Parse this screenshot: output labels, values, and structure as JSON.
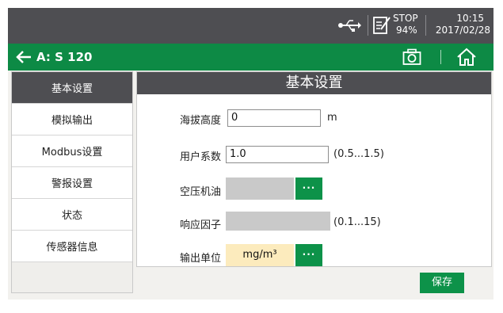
{
  "status_bar": {
    "mode": "STOP",
    "battery": "94%",
    "time": "10:15",
    "date": "2017/02/28",
    "icons": [
      "usb-icon",
      "document-edit-icon"
    ]
  },
  "title_bar": {
    "device": "A: S 120",
    "icons": [
      "back-arrow-icon",
      "camera-icon",
      "home-icon"
    ]
  },
  "sidebar": {
    "items": [
      {
        "label": "基本设置",
        "active": true
      },
      {
        "label": "模拟输出",
        "active": false
      },
      {
        "label": "Modbus设置",
        "active": false
      },
      {
        "label": "警报设置",
        "active": false
      },
      {
        "label": "状态",
        "active": false
      },
      {
        "label": "传感器信息",
        "active": false
      }
    ]
  },
  "panel": {
    "title": "基本设置",
    "altitude": {
      "label": "海拔高度",
      "value": "0",
      "unit": "m"
    },
    "user_factor": {
      "label": "用户系数",
      "value": "1.0",
      "range": "(0.5...1.5)"
    },
    "compressor_oil": {
      "label": "空压机油",
      "value": "",
      "button": "···"
    },
    "response_factor": {
      "label": "响应因子",
      "value": "",
      "range": "(0.1...15)"
    },
    "output_unit": {
      "label": "输出单位",
      "value": "mg/m³",
      "button": "···"
    }
  },
  "actions": {
    "save": "保存"
  },
  "colors": {
    "accent_green": "#0d8a45",
    "dark_bar": "#4e4e52",
    "unit_highlight": "#fcebbd"
  }
}
